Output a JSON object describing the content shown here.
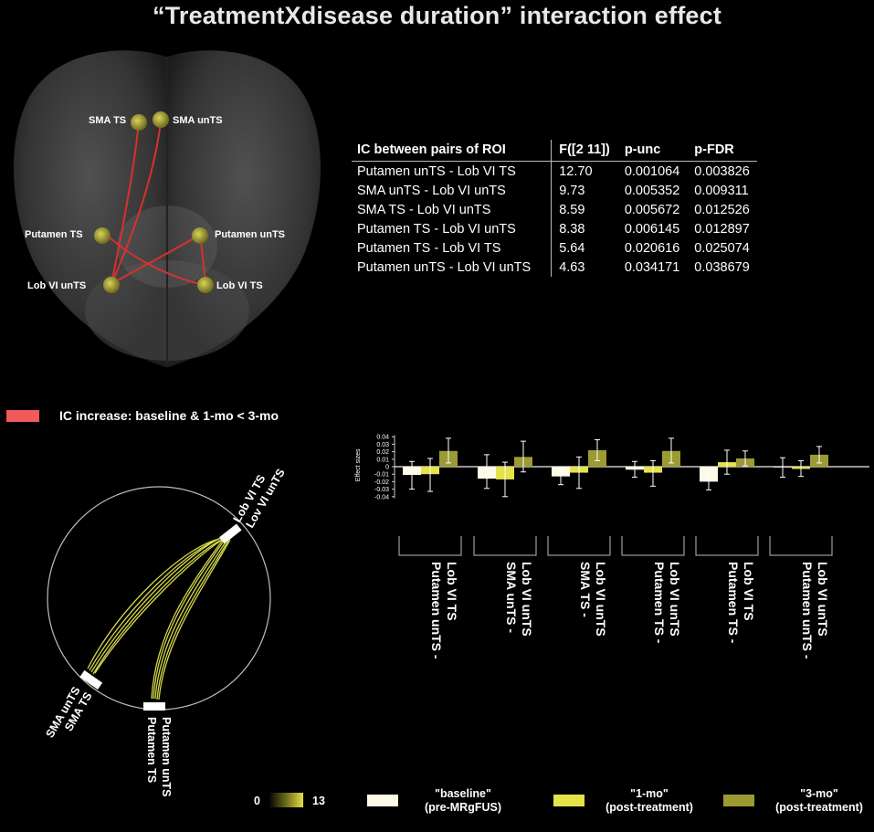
{
  "title": "“TreatmentXdisease duration” interaction effect",
  "brain": {
    "roi_labels": [
      "SMA TS",
      "SMA unTS",
      "Putamen TS",
      "Putamen unTS",
      "Lob VI unTS",
      "Lob VI TS"
    ]
  },
  "table": {
    "headers": [
      "IC between pairs of ROI",
      "F([2 11])",
      "p-unc",
      "p-FDR"
    ],
    "rows": [
      [
        "Putamen unTS - Lob VI TS",
        "12.70",
        "0.001064",
        "0.003826"
      ],
      [
        "SMA unTS - Lob VI unTS",
        "9.73",
        "0.005352",
        "0.009311"
      ],
      [
        "SMA TS - Lob VI unTS",
        "8.59",
        "0.005672",
        "0.012526"
      ],
      [
        "Putamen TS  - Lob VI unTS",
        "8.38",
        "0.006145",
        "0.012897"
      ],
      [
        "Putamen TS - Lob VI TS",
        "5.64",
        "0.020616",
        "0.025074"
      ],
      [
        "Putamen unTS - Lob VI unTS",
        "4.63",
        "0.034171",
        "0.038679"
      ]
    ]
  },
  "ic_legend": {
    "label": "IC increase: baseline & 1-mo < 3-mo",
    "color": "#f05a5a"
  },
  "circle": {
    "labels": {
      "lob_vi_ts": "Lob VI TS",
      "lov_vi_unts": "Lov VI unTS",
      "sma_unts": "SMA unTS",
      "sma_ts": "SMA TS",
      "putamen_unts": "Putamen unTS",
      "putamen_ts": "Putamen TS"
    }
  },
  "colorbar": {
    "min": "0",
    "max": "13"
  },
  "chart_data": {
    "type": "bar",
    "ylabel": "Effect sizes",
    "ylim": [
      -0.045,
      0.045
    ],
    "yticks": [
      "0.04",
      "0.03",
      "0.02",
      "0.01",
      "0",
      "-0.01",
      "-0.02",
      "-0.03",
      "-0.04"
    ],
    "categories": [
      "Putamen unTS - Lob VI TS",
      "SMA unTS - Lob VI unTS",
      "SMA TS - Lob VI unTS",
      "Putamen TS - Lob VI unTS",
      "Putamen TS - Lob VI TS",
      "Putamen unTS - Lob VI unTS"
    ],
    "series": [
      {
        "name": "\"baseline\"",
        "sub": "(pre-MRgFUS)",
        "color": "#fdfbe8",
        "values": [
          -0.011,
          -0.016,
          -0.013,
          -0.004,
          -0.02,
          -0.001
        ],
        "err_lo": [
          -0.03,
          -0.029,
          -0.024,
          -0.014,
          -0.031,
          -0.014
        ],
        "err_hi": [
          0.007,
          0.016,
          -0.003,
          0.007,
          -0.01,
          0.012
        ]
      },
      {
        "name": "\"1-mo\"",
        "sub": "(post-treatment)",
        "color": "#e6e24a",
        "values": [
          -0.01,
          -0.017,
          -0.008,
          -0.008,
          0.006,
          -0.003
        ],
        "err_lo": [
          -0.033,
          -0.04,
          -0.029,
          -0.026,
          -0.01,
          -0.013
        ],
        "err_hi": [
          0.011,
          0.006,
          0.013,
          0.008,
          0.022,
          0.008
        ]
      },
      {
        "name": "\"3-mo\"",
        "sub": "(post-treatment)",
        "color": "#9c9a32",
        "values": [
          0.021,
          0.013,
          0.022,
          0.021,
          0.011,
          0.016
        ],
        "err_lo": [
          0.005,
          -0.007,
          0.008,
          0.005,
          0.001,
          0.005
        ],
        "err_hi": [
          0.038,
          0.034,
          0.036,
          0.038,
          0.021,
          0.027
        ]
      }
    ]
  }
}
